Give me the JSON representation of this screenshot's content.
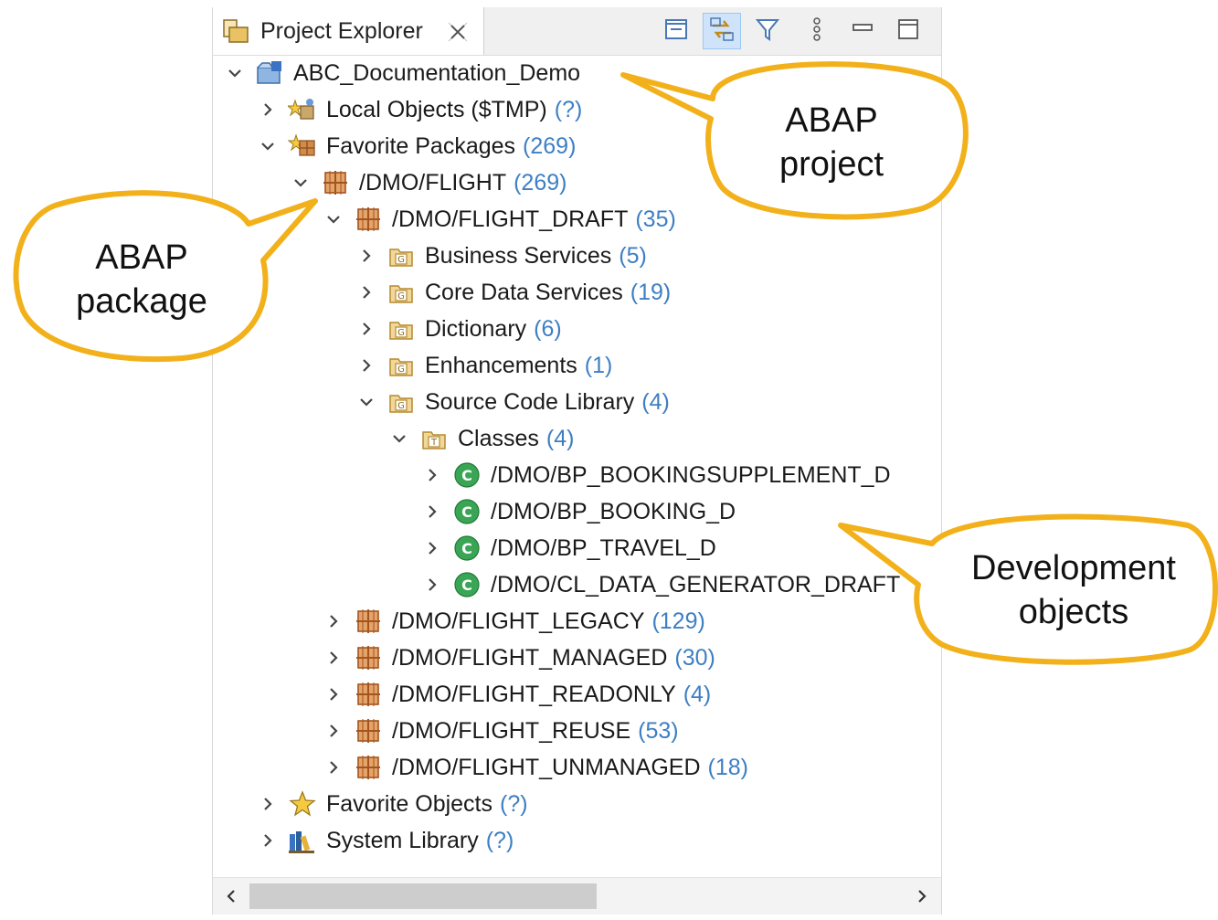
{
  "tab": {
    "title": "Project Explorer"
  },
  "toolbar": {
    "buttons": [
      {
        "name": "collapse-all",
        "icon": "collapse-all-icon"
      },
      {
        "name": "link-with-editor",
        "icon": "link-sync-icon",
        "active": true
      },
      {
        "name": "filter",
        "icon": "filter-icon"
      },
      {
        "name": "view-menu",
        "icon": "kebab-menu-icon"
      },
      {
        "name": "minimize",
        "icon": "minimize-icon"
      },
      {
        "name": "maximize",
        "icon": "maximize-icon"
      }
    ]
  },
  "tree": {
    "project": {
      "label": "ABC_Documentation_Demo",
      "count": ""
    },
    "local_objects": {
      "label": "Local Objects ($TMP)",
      "count": "(?)"
    },
    "favorite_packages": {
      "label": "Favorite Packages",
      "count": "(269)"
    },
    "flight": {
      "label": "/DMO/FLIGHT",
      "count": "(269)"
    },
    "flight_draft": {
      "label": "/DMO/FLIGHT_DRAFT",
      "count": "(35)"
    },
    "business_services": {
      "label": "Business Services",
      "count": "(5)"
    },
    "core_data_services": {
      "label": "Core Data Services",
      "count": "(19)"
    },
    "dictionary": {
      "label": "Dictionary",
      "count": "(6)"
    },
    "enhancements": {
      "label": "Enhancements",
      "count": "(1)"
    },
    "source_code_library": {
      "label": "Source Code Library",
      "count": "(4)"
    },
    "classes": {
      "label": "Classes",
      "count": "(4)"
    },
    "class_items": [
      {
        "label": "/DMO/BP_BOOKINGSUPPLEMENT_D"
      },
      {
        "label": "/DMO/BP_BOOKING_D"
      },
      {
        "label": "/DMO/BP_TRAVEL_D"
      },
      {
        "label": "/DMO/CL_DATA_GENERATOR_DRAFT"
      }
    ],
    "flight_packages": [
      {
        "label": "/DMO/FLIGHT_LEGACY",
        "count": "(129)"
      },
      {
        "label": "/DMO/FLIGHT_MANAGED",
        "count": "(30)"
      },
      {
        "label": "/DMO/FLIGHT_READONLY",
        "count": "(4)"
      },
      {
        "label": "/DMO/FLIGHT_REUSE",
        "count": "(53)"
      },
      {
        "label": "/DMO/FLIGHT_UNMANAGED",
        "count": "(18)"
      }
    ],
    "favorite_objects": {
      "label": "Favorite Objects",
      "count": "(?)"
    },
    "system_library": {
      "label": "System Library",
      "count": "(?)"
    }
  },
  "callouts": {
    "project": {
      "line1": "ABAP",
      "line2": "project"
    },
    "package": {
      "line1": "ABAP",
      "line2": "package"
    },
    "objects": {
      "line1": "Development",
      "line2": "objects"
    }
  },
  "colors": {
    "callout_border": "#f2b11a",
    "count_text": "#3d7fc4",
    "package_icon": "#b35a2a",
    "folder_icon": "#d9a441",
    "class_icon": "#3aa655",
    "active_toolbar": "#cfe4fa"
  }
}
